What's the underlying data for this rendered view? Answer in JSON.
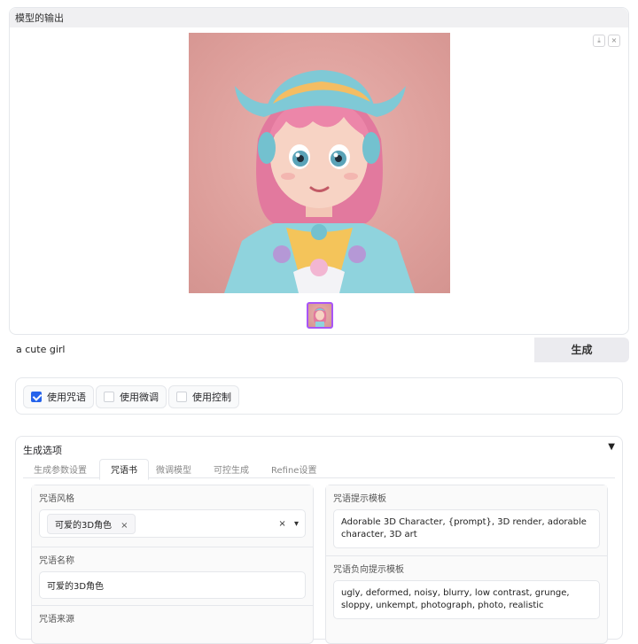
{
  "output": {
    "header": "模型的输出",
    "download_icon": "download-icon",
    "close_icon": "close-icon"
  },
  "prompt": {
    "value": "a cute girl",
    "generate_label": "生成"
  },
  "checkboxes": [
    {
      "label": "使用咒语",
      "checked": true
    },
    {
      "label": "使用微调",
      "checked": false
    },
    {
      "label": "使用控制",
      "checked": false
    }
  ],
  "options": {
    "title": "生成选项",
    "collapse_icon": "▼",
    "tabs": [
      "生成参数设置",
      "咒语书",
      "微调模型",
      "可控生成",
      "Refine设置"
    ],
    "active_tab": "咒语书",
    "left": {
      "style_label": "咒语风格",
      "style_tag": "可爱的3D角色",
      "tag_remove": "×",
      "clear_icon": "×",
      "dropdown_icon": "▾",
      "name_label": "咒语名称",
      "name_value": "可爱的3D角色",
      "source_label": "咒语来源"
    },
    "right": {
      "prompt_template_label": "咒语提示模板",
      "prompt_template_value": "Adorable 3D Character, {prompt}, 3D render, adorable character, 3D art",
      "negative_label": "咒语负向提示模板",
      "negative_value": "ugly, deformed, noisy, blurry, low contrast, grunge, sloppy, unkempt, photograph, photo, realistic"
    }
  },
  "colors": {
    "accent": "#2563eb",
    "thumb_border": "#a855f7",
    "image_bg": "#dc9d99"
  }
}
